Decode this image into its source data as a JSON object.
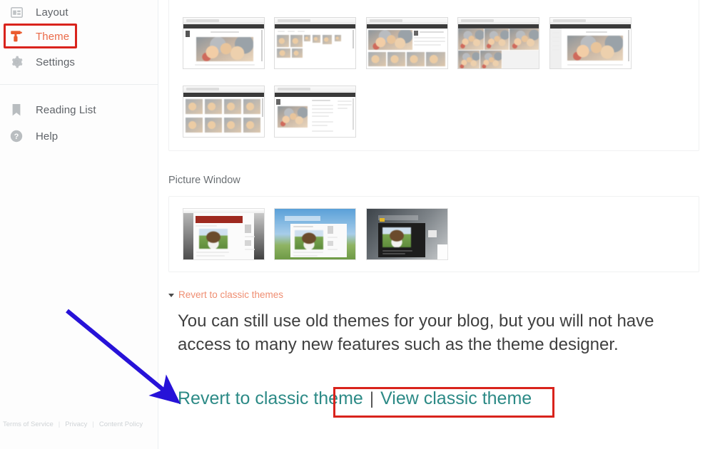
{
  "sidebar": {
    "items": [
      {
        "label": "Layout",
        "icon": "layout-icon",
        "active": false
      },
      {
        "label": "Theme",
        "icon": "paint-roller-icon",
        "active": true
      },
      {
        "label": "Settings",
        "icon": "gear-icon",
        "active": false
      },
      {
        "label": "Reading List",
        "icon": "bookmark-icon",
        "active": false
      },
      {
        "label": "Help",
        "icon": "help-circle-icon",
        "active": false
      }
    ],
    "footer": {
      "terms": "Terms of Service",
      "privacy": "Privacy",
      "content_policy": "Content Policy",
      "separator": "|"
    }
  },
  "main": {
    "contempo_section": {
      "thumbnails": [
        {
          "name": "contempo-classic"
        },
        {
          "name": "contempo-snapshot"
        },
        {
          "name": "contempo-sidebar"
        },
        {
          "name": "contempo-grid"
        },
        {
          "name": "contempo-magazine"
        },
        {
          "name": "contempo-mosaic"
        },
        {
          "name": "contempo-article"
        }
      ]
    },
    "picture_window": {
      "label": "Picture Window",
      "thumbnails": [
        {
          "name": "picture-window-red"
        },
        {
          "name": "picture-window-blue"
        },
        {
          "name": "picture-window-dark"
        }
      ]
    },
    "revert": {
      "toggle_label": "Revert to classic themes",
      "description": "You can still use old themes for your blog, but you will not have access to many new features such as the theme designer.",
      "revert_link": "Revert to classic theme",
      "link_divider": "|",
      "view_link": "View classic theme"
    }
  },
  "annotations": {
    "theme_highlight_color": "#d9231c",
    "revert_highlight_color": "#d9231c",
    "arrow_color": "#2712d8"
  },
  "colors": {
    "accent_orange": "#ea6a48",
    "link_teal": "#2c8a86",
    "revert_toggle_orange": "#ef8e72",
    "sidebar_text": "#5f6368"
  }
}
